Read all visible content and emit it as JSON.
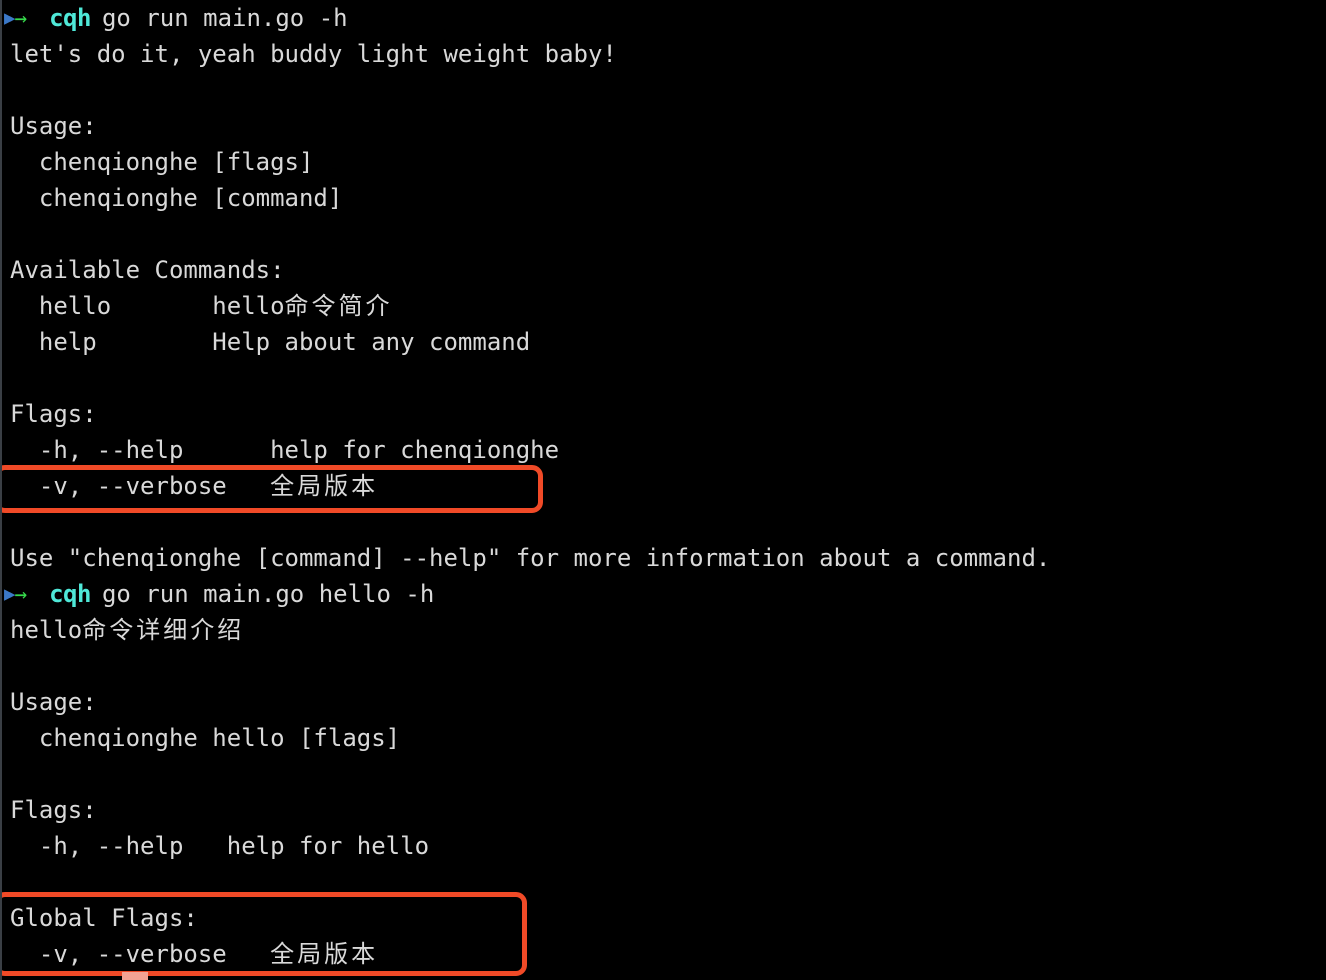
{
  "terminal": {
    "background_color": "#000000",
    "foreground_color": "#d9d9d9",
    "highlight_color": "#f04a27",
    "prompt_user_color": "#4fe8d8",
    "prompt_arrow_color": "#36d94b",
    "prompt_triangle_color": "#3b78c8"
  },
  "prompt": {
    "triangle_icon": "▶",
    "arrow_icon": "→",
    "user": "cqh"
  },
  "commands": {
    "first": "go run main.go -h",
    "second": "go run main.go hello -h"
  },
  "output_1": {
    "banner": "let's do it, yeah buddy light weight baby!",
    "usage_header": "Usage:",
    "usage_lines": [
      "  chenqionghe [flags]",
      "  chenqionghe [command]"
    ],
    "available_commands_header": "Available Commands:",
    "available_commands": [
      "  hello       hello命令简介",
      "  help        Help about any command"
    ],
    "flags_header": "Flags:",
    "flags": [
      "  -h, --help      help for chenqionghe",
      "  -v, --verbose   全局版本"
    ],
    "footer": "Use \"chenqionghe [command] --help\" for more information about a command."
  },
  "output_2": {
    "banner": "hello命令详细介绍",
    "usage_header": "Usage:",
    "usage_lines": [
      "  chenqionghe hello [flags]"
    ],
    "flags_header": "Flags:",
    "flags": [
      "  -h, --help   help for hello"
    ],
    "global_flags_header": "Global Flags:",
    "global_flags": [
      "  -v, --verbose   全局版本"
    ]
  },
  "annotations": {
    "box_1_label": "verbose-flag-highlight",
    "box_2_label": "global-flags-highlight"
  }
}
